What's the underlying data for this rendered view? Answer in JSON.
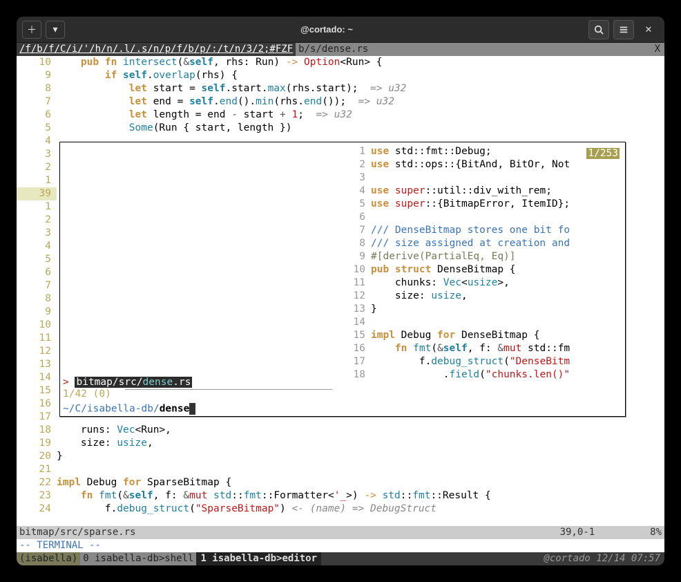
{
  "titlebar": {
    "title": "@cortado: ~"
  },
  "tabs": {
    "active": "/f/b/f/C/i/'/h/n/.l/.s/n/p/f/b/p/:/t/n/3/2;#FZF",
    "inactive": "b/s/dense.rs",
    "right": "X"
  },
  "main_gutter": [
    "10",
    "9",
    "8",
    "7",
    "6",
    "5",
    "4",
    "3",
    "2",
    "1",
    "39",
    "1",
    "2",
    "3",
    "4",
    "5",
    "6",
    "7",
    "8",
    "9",
    "10",
    "11",
    "12",
    "13",
    "14",
    "15",
    "16",
    "17",
    "18",
    "19",
    "20",
    "21",
    "22",
    "23",
    "24"
  ],
  "main_code": [
    [
      {
        "t": "    "
      },
      {
        "t": "pub fn ",
        "c": "kw"
      },
      {
        "t": "intersect",
        "c": "fn"
      },
      {
        "t": "("
      },
      {
        "t": "&",
        "c": "op"
      },
      {
        "t": "self",
        "c": "self"
      },
      {
        "t": ", rhs: "
      },
      {
        "t": "Run",
        "c": "ident"
      },
      {
        "t": ") "
      },
      {
        "t": "->",
        "c": "arrow"
      },
      {
        "t": " "
      },
      {
        "t": "Option",
        "c": "str"
      },
      {
        "t": "<"
      },
      {
        "t": "Run",
        "c": "ident"
      },
      {
        "t": "> {"
      }
    ],
    [
      {
        "t": "        "
      },
      {
        "t": "if ",
        "c": "kw"
      },
      {
        "t": "self",
        "c": "self"
      },
      {
        "t": "."
      },
      {
        "t": "overlap",
        "c": "fn"
      },
      {
        "t": "(rhs) {"
      }
    ],
    [
      {
        "t": "            "
      },
      {
        "t": "let ",
        "c": "kw"
      },
      {
        "t": "start = "
      },
      {
        "t": "self",
        "c": "self"
      },
      {
        "t": "."
      },
      {
        "t": "start",
        "c": "ident"
      },
      {
        "t": "."
      },
      {
        "t": "max",
        "c": "fn"
      },
      {
        "t": "(rhs.start);  "
      },
      {
        "t": "=> ",
        "c": "cm"
      },
      {
        "t": "u32",
        "c": "cm"
      }
    ],
    [
      {
        "t": "            "
      },
      {
        "t": "let ",
        "c": "kw"
      },
      {
        "t": "end = "
      },
      {
        "t": "self",
        "c": "self"
      },
      {
        "t": "."
      },
      {
        "t": "end",
        "c": "fn"
      },
      {
        "t": "()."
      },
      {
        "t": "min",
        "c": "fn"
      },
      {
        "t": "(rhs."
      },
      {
        "t": "end",
        "c": "fn"
      },
      {
        "t": "());  "
      },
      {
        "t": "=> ",
        "c": "cm"
      },
      {
        "t": "u32",
        "c": "cm"
      }
    ],
    [
      {
        "t": "            "
      },
      {
        "t": "let ",
        "c": "kw"
      },
      {
        "t": "length = end "
      },
      {
        "t": "-",
        "c": "op"
      },
      {
        "t": " start "
      },
      {
        "t": "+",
        "c": "op"
      },
      {
        "t": " "
      },
      {
        "t": "1",
        "c": "num"
      },
      {
        "t": ";  "
      },
      {
        "t": "=> ",
        "c": "cm"
      },
      {
        "t": "u32",
        "c": "cm"
      }
    ],
    [
      {
        "t": "            "
      },
      {
        "t": "Some",
        "c": "ty"
      },
      {
        "t": "(Run { start, length })"
      }
    ],
    [
      {
        "t": ""
      }
    ],
    [
      {
        "t": ""
      }
    ],
    [
      {
        "t": ""
      }
    ],
    [
      {
        "t": ""
      }
    ],
    [
      {
        "t": ""
      }
    ],
    [
      {
        "t": ""
      }
    ],
    [
      {
        "t": ""
      }
    ],
    [
      {
        "t": ""
      }
    ],
    [
      {
        "t": ""
      }
    ],
    [
      {
        "t": ""
      }
    ],
    [
      {
        "t": ""
      }
    ],
    [
      {
        "t": ""
      }
    ],
    [
      {
        "t": ""
      }
    ],
    [
      {
        "t": ""
      }
    ],
    [
      {
        "t": ""
      }
    ],
    [
      {
        "t": ""
      }
    ],
    [
      {
        "t": ""
      }
    ],
    [
      {
        "t": ""
      }
    ],
    [
      {
        "t": ""
      }
    ],
    [
      {
        "t": ""
      }
    ],
    [
      {
        "t": ""
      }
    ],
    [
      {
        "t": ""
      }
    ],
    [
      {
        "t": "    runs: "
      },
      {
        "t": "Vec",
        "c": "ty"
      },
      {
        "t": "<"
      },
      {
        "t": "Run",
        "c": "ident"
      },
      {
        "t": ">,"
      }
    ],
    [
      {
        "t": "    size: "
      },
      {
        "t": "usize",
        "c": "ty"
      },
      {
        "t": ","
      }
    ],
    [
      {
        "t": "}"
      }
    ],
    [
      {
        "t": ""
      }
    ],
    [
      {
        "t": "impl ",
        "c": "kw"
      },
      {
        "t": "Debug",
        "c": "ident"
      },
      {
        "t": " "
      },
      {
        "t": "for ",
        "c": "kw"
      },
      {
        "t": "SparseBitmap {"
      }
    ],
    [
      {
        "t": "    "
      },
      {
        "t": "fn ",
        "c": "kw"
      },
      {
        "t": "fmt",
        "c": "fn"
      },
      {
        "t": "("
      },
      {
        "t": "&",
        "c": "op"
      },
      {
        "t": "self",
        "c": "self"
      },
      {
        "t": ", f: "
      },
      {
        "t": "&",
        "c": "op"
      },
      {
        "t": "mut ",
        "c": "mut"
      },
      {
        "t": "std",
        "c": "ty"
      },
      {
        "t": "::"
      },
      {
        "t": "fmt",
        "c": "ty"
      },
      {
        "t": "::"
      },
      {
        "t": "Formatter",
        "c": "ident"
      },
      {
        "t": "<"
      },
      {
        "t": "'_",
        "c": "str"
      },
      {
        "t": ">) "
      },
      {
        "t": "->",
        "c": "arrow"
      },
      {
        "t": " "
      },
      {
        "t": "std",
        "c": "ty"
      },
      {
        "t": "::"
      },
      {
        "t": "fmt",
        "c": "ty"
      },
      {
        "t": "::"
      },
      {
        "t": "Result",
        "c": "ident"
      },
      {
        "t": " {"
      }
    ],
    [
      {
        "t": "        f."
      },
      {
        "t": "debug_struct",
        "c": "fn"
      },
      {
        "t": "("
      },
      {
        "t": "\"SparseBitmap\"",
        "c": "str"
      },
      {
        "t": ") "
      },
      {
        "t": "<- (name) => DebugStruct",
        "c": "cm"
      }
    ]
  ],
  "fzf": {
    "selected_prefix": "> ",
    "selected_path_parts": [
      "bitmap",
      "/",
      "src",
      "/",
      "dense",
      ".",
      "rs"
    ],
    "count": "1/42 (0)",
    "prompt_prefix": "~/C/isabella-db/",
    "query": "dense",
    "badge": "1/253",
    "preview_gutter": [
      "1",
      "2",
      "3",
      "4",
      "5",
      "6",
      "7",
      "8",
      "9",
      "10",
      "11",
      "12",
      "13",
      "14",
      "15",
      "16",
      "17",
      "18"
    ],
    "preview_code": [
      [
        {
          "t": "use ",
          "c": "kw"
        },
        {
          "t": "std",
          "c": "ident"
        },
        {
          "t": "::"
        },
        {
          "t": "fmt",
          "c": "ident"
        },
        {
          "t": "::"
        },
        {
          "t": "Debug",
          "c": "ident"
        },
        {
          "t": ";"
        }
      ],
      [
        {
          "t": "use ",
          "c": "kw"
        },
        {
          "t": "std",
          "c": "ident"
        },
        {
          "t": "::"
        },
        {
          "t": "ops",
          "c": "ident"
        },
        {
          "t": "::{"
        },
        {
          "t": "BitAnd",
          "c": "ident"
        },
        {
          "t": ", "
        },
        {
          "t": "BitOr",
          "c": "ident"
        },
        {
          "t": ", "
        },
        {
          "t": "Not",
          "c": "ident"
        }
      ],
      [
        {
          "t": ""
        }
      ],
      [
        {
          "t": "use ",
          "c": "kw"
        },
        {
          "t": "super",
          "c": "str"
        },
        {
          "t": "::"
        },
        {
          "t": "util",
          "c": "ident"
        },
        {
          "t": "::"
        },
        {
          "t": "div_with_rem",
          "c": "ident"
        },
        {
          "t": ";"
        }
      ],
      [
        {
          "t": "use ",
          "c": "kw"
        },
        {
          "t": "super",
          "c": "str"
        },
        {
          "t": "::{"
        },
        {
          "t": "BitmapError",
          "c": "ident"
        },
        {
          "t": ", "
        },
        {
          "t": "ItemID",
          "c": "ident"
        },
        {
          "t": "};"
        }
      ],
      [
        {
          "t": ""
        }
      ],
      [
        {
          "t": "/// DenseBitmap stores one bit fo",
          "c": "doc"
        }
      ],
      [
        {
          "t": "/// size assigned at creation and",
          "c": "doc"
        }
      ],
      [
        {
          "t": "#[derive(PartialEq, Eq)]",
          "c": "attr"
        }
      ],
      [
        {
          "t": "pub struct ",
          "c": "kw"
        },
        {
          "t": "DenseBitmap",
          "c": "ident"
        },
        {
          "t": " {"
        }
      ],
      [
        {
          "t": "    chunks: "
        },
        {
          "t": "Vec",
          "c": "ty"
        },
        {
          "t": "<"
        },
        {
          "t": "usize",
          "c": "ty"
        },
        {
          "t": ">,"
        }
      ],
      [
        {
          "t": "    size: "
        },
        {
          "t": "usize",
          "c": "ty"
        },
        {
          "t": ","
        }
      ],
      [
        {
          "t": "}"
        }
      ],
      [
        {
          "t": ""
        }
      ],
      [
        {
          "t": "impl ",
          "c": "kw"
        },
        {
          "t": "Debug",
          "c": "ident"
        },
        {
          "t": " "
        },
        {
          "t": "for ",
          "c": "kw"
        },
        {
          "t": "DenseBitmap",
          "c": "ident"
        },
        {
          "t": " {"
        }
      ],
      [
        {
          "t": "    "
        },
        {
          "t": "fn ",
          "c": "kw"
        },
        {
          "t": "fmt",
          "c": "fn"
        },
        {
          "t": "("
        },
        {
          "t": "&",
          "c": "op"
        },
        {
          "t": "self",
          "c": "self"
        },
        {
          "t": ", f: "
        },
        {
          "t": "&",
          "c": "op"
        },
        {
          "t": "mut ",
          "c": "mut"
        },
        {
          "t": "std",
          "c": "ident"
        },
        {
          "t": "::"
        },
        {
          "t": "fm",
          "c": "ident"
        }
      ],
      [
        {
          "t": "        f."
        },
        {
          "t": "debug_struct",
          "c": "fn"
        },
        {
          "t": "("
        },
        {
          "t": "\"DenseBitm",
          "c": "str"
        }
      ],
      [
        {
          "t": "            ."
        },
        {
          "t": "field",
          "c": "fn"
        },
        {
          "t": "("
        },
        {
          "t": "\"chunks.len()\"",
          "c": "str"
        }
      ]
    ]
  },
  "status": {
    "file": "bitmap/src/sparse.rs",
    "pos": "39,0-1",
    "pct": "8%"
  },
  "mode": "-- TERMINAL --",
  "tmux": {
    "session": "(isabella)",
    "win0": "0 isabella-db>shell",
    "win1": "1 isabella-db>editor",
    "host": "@cortado 12/14 07:57"
  }
}
